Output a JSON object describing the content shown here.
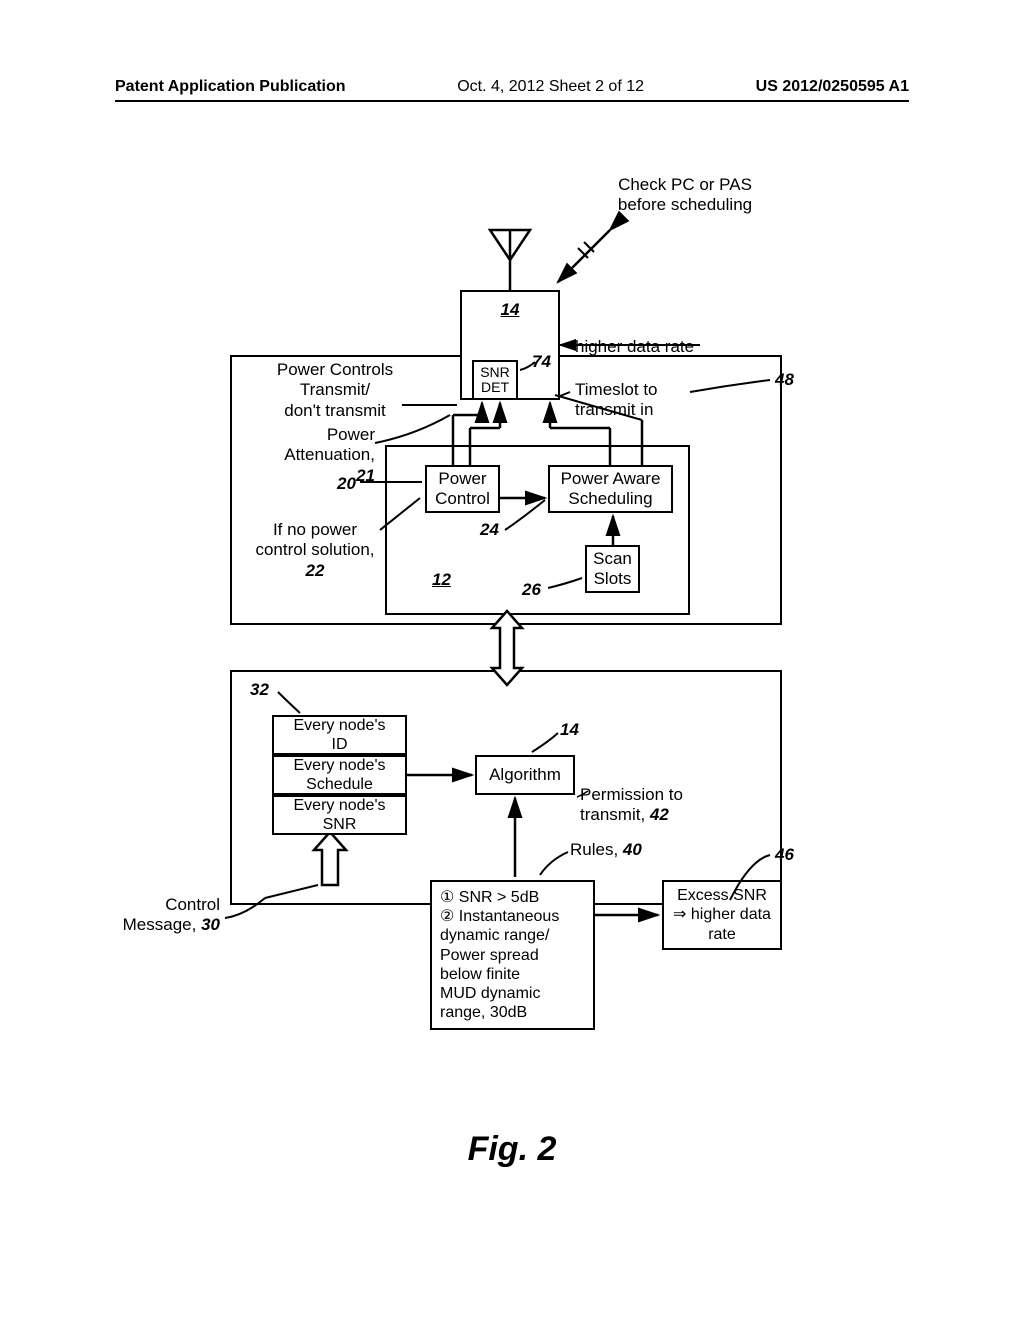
{
  "header": {
    "left": "Patent Application Publication",
    "center": "Oct. 4, 2012  Sheet 2 of 12",
    "right": "US 2012/0250595 A1"
  },
  "labels": {
    "check_pc": "Check PC or PAS\nbefore scheduling",
    "higher_data_rate": "higher data rate",
    "ref48": "48",
    "timeslot": "Timeslot to\ntransmit in",
    "power_controls": "Power Controls\nTransmit/\ndon't transmit",
    "power_atten": "Power\nAttenuation,",
    "ref21": "21",
    "ref20": "20",
    "ref74": "74",
    "ref14a": "14",
    "snr_det": "SNR\nDET",
    "power_control_box": "Power\nControl",
    "pas_box": "Power Aware\nScheduling",
    "ref24": "24",
    "if_no_power": "If no power\ncontrol solution,",
    "ref22": "22",
    "ref12": "12",
    "scan_slots": "Scan\nSlots",
    "ref26": "26",
    "ref32": "32",
    "every_id": "Every node's\nID",
    "every_schedule": "Every node's\nSchedule",
    "every_snr": "Every node's\nSNR",
    "ref14b": "14",
    "algorithm": "Algorithm",
    "permission": "Permission to\ntransmit,",
    "ref42": "42",
    "rules": "Rules,",
    "ref40": "40",
    "ref46": "46",
    "rules_body": "① SNR > 5dB\n② Instantaneous\ndynamic range/\nPower spread\nbelow finite\nMUD dynamic\nrange, 30dB",
    "excess_snr": "Excess SNR\n⇒ higher data\nrate",
    "control_msg": "Control\nMessage,",
    "ref30": "30",
    "fig": "Fig. 2"
  }
}
